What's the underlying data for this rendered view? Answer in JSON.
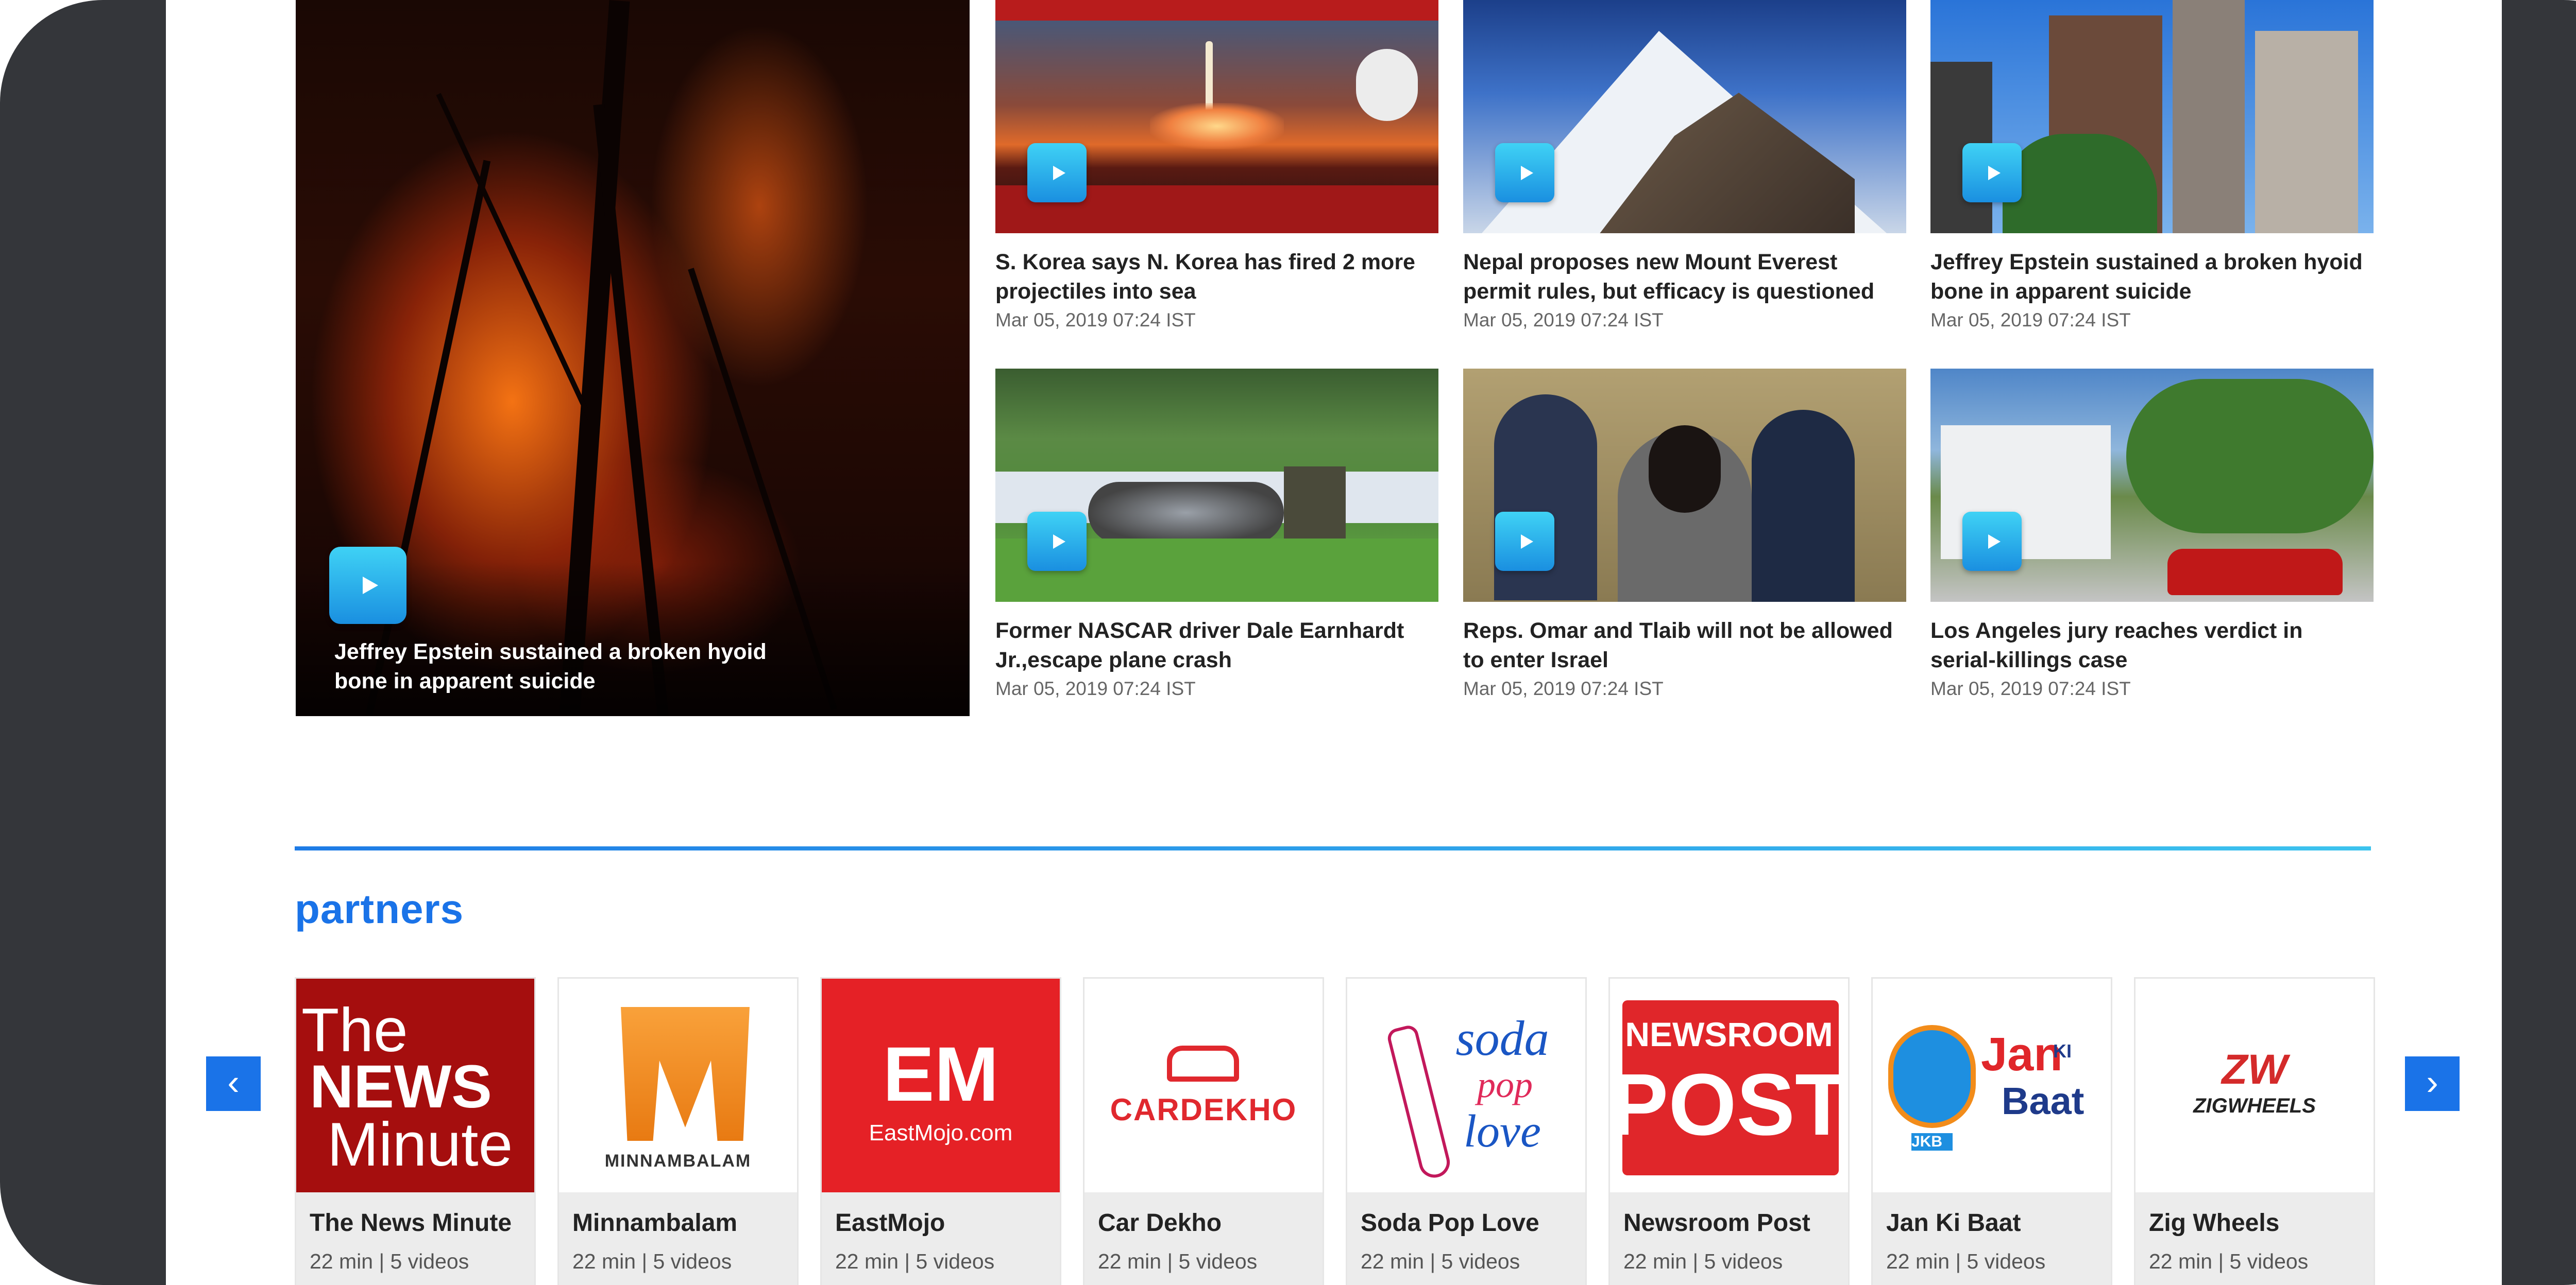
{
  "hero": {
    "title": "Jeffrey Epstein sustained a broken hyoid bone in apparent suicide"
  },
  "videos": [
    {
      "title": "S. Korea says N. Korea has fired 2 more projectiles into sea",
      "date": "Mar 05, 2019 07:24 IST",
      "thumb": "rocket-launch-news",
      "bg": "#7a2418"
    },
    {
      "title": "Nepal proposes new Mount Everest permit rules, but efficacy is questioned",
      "date": "Mar 05, 2019 07:24 IST",
      "thumb": "mountain",
      "bg": "#2e5fb3"
    },
    {
      "title": "Jeffrey Epstein sustained a broken hyoid bone in apparent suicide",
      "date": "Mar 05, 2019 07:24 IST",
      "thumb": "city-buildings",
      "bg": "#3d8be0"
    },
    {
      "title": "Former NASCAR driver Dale Earnhardt Jr.,escape plane crash",
      "date": "Mar 05, 2019 07:24 IST",
      "thumb": "plane-crash",
      "bg": "#4f8a3a"
    },
    {
      "title": "Reps. Omar and Tlaib will not be allowed to enter Israel",
      "date": "Mar 05, 2019 07:24 IST",
      "thumb": "congress-hearing",
      "bg": "#8a7a52"
    },
    {
      "title": "Los Angeles jury reaches verdict in serial-killings case",
      "date": "Mar 05, 2019 07:24 IST",
      "thumb": "street-house",
      "bg": "#4f7fb0"
    }
  ],
  "partners_section": {
    "title": "partners",
    "prev_icon": "chevron-left-icon",
    "next_icon": "chevron-right-icon",
    "prev_glyph": "‹",
    "next_glyph": "›"
  },
  "partners": [
    {
      "name": "The News Minute",
      "meta": "22 min | 5 videos",
      "logo_lines": [
        "The",
        "NEWS",
        "Minute"
      ]
    },
    {
      "name": "Minnambalam",
      "meta": "22 min | 5 videos",
      "logo_lines": [
        "MINNAMBALAM"
      ]
    },
    {
      "name": "EastMojo",
      "meta": "22 min | 5 videos",
      "logo_lines": [
        "EM",
        "EastMojo.com"
      ]
    },
    {
      "name": "Car Dekho",
      "meta": "22 min | 5 videos",
      "logo_lines": [
        "CARDEKHO"
      ]
    },
    {
      "name": "Soda Pop Love",
      "meta": "22 min | 5 videos",
      "logo_lines": [
        "soda",
        "pop",
        "love"
      ]
    },
    {
      "name": "Newsroom Post",
      "meta": "22 min | 5 videos",
      "logo_lines": [
        "NEWSROOM",
        "POST"
      ]
    },
    {
      "name": "Jan Ki Baat",
      "meta": "22 min | 5 videos",
      "logo_lines": [
        "Jan",
        "KI",
        "Baat",
        "JKB"
      ]
    },
    {
      "name": "Zig Wheels",
      "meta": "22 min | 5 videos",
      "logo_lines": [
        "ZW",
        "ZIGWHEELS"
      ]
    }
  ],
  "colors": {
    "accent": "#1a73e8",
    "frame": "#34363a"
  }
}
